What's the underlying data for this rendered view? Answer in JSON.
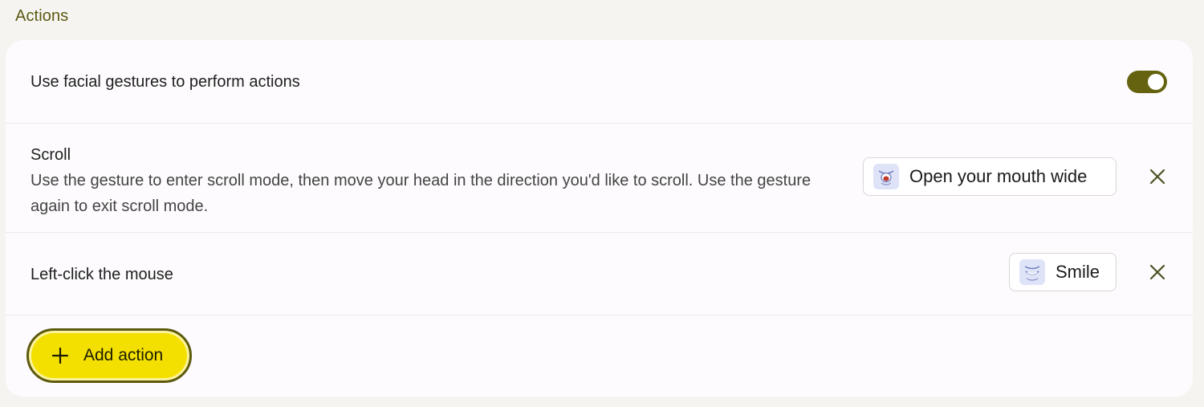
{
  "section": {
    "title": "Actions"
  },
  "master": {
    "label": "Use facial gestures to perform actions",
    "enabled": true
  },
  "actions": [
    {
      "title": "Scroll",
      "description": "Use the gesture to enter scroll mode, then move your head in the direction you'd like to scroll. Use the gesture again to exit scroll mode.",
      "gesture": "Open your mouth wide",
      "gesture_icon": "open-mouth-face-icon"
    },
    {
      "title": "Left-click the mouse",
      "gesture": "Smile",
      "gesture_icon": "smile-face-icon"
    }
  ],
  "add_button": {
    "label": "Add action"
  },
  "colors": {
    "accent": "#656310",
    "title_text": "#5a5a12",
    "add_button_bg": "#f4e000",
    "chip_icon_bg": "#dfe3f8",
    "background": "#f6f4f1",
    "card": "#fdfbfd"
  }
}
